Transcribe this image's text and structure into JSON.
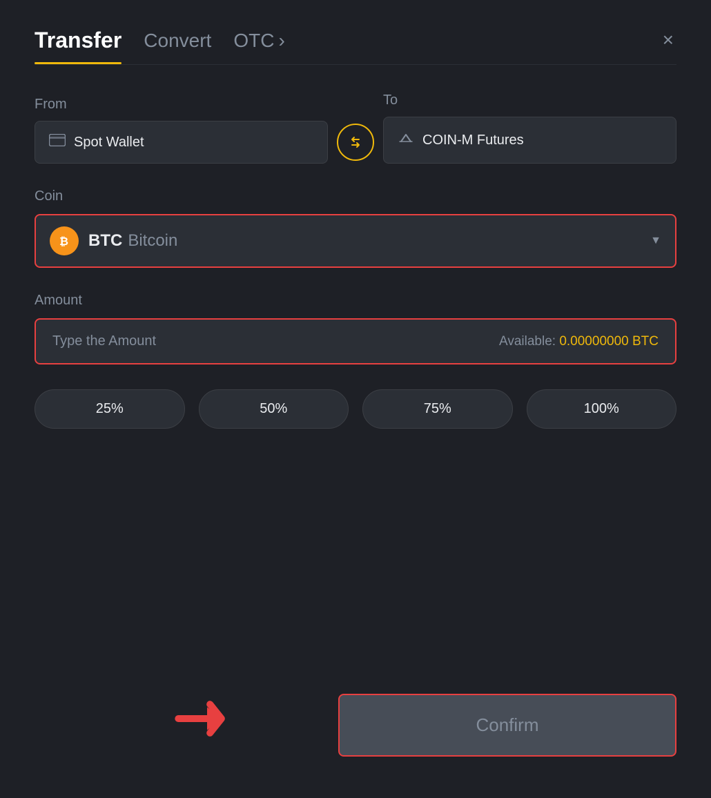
{
  "header": {
    "tab_transfer": "Transfer",
    "tab_convert": "Convert",
    "tab_otc": "OTC",
    "close_label": "×"
  },
  "from_section": {
    "label": "From",
    "wallet_icon": "🪙",
    "wallet_name": "Spot Wallet"
  },
  "to_section": {
    "label": "To",
    "wallet_icon": "↑",
    "wallet_name": "COIN-M Futures"
  },
  "swap": {
    "icon": "⇄"
  },
  "coin_section": {
    "label": "Coin",
    "symbol": "BTC",
    "name": "Bitcoin",
    "btc_letter": "₿"
  },
  "amount_section": {
    "label": "Amount",
    "placeholder": "Type the Amount",
    "available_label": "Available:",
    "available_value": "0.00000000 BTC"
  },
  "percentage_buttons": [
    {
      "label": "25%"
    },
    {
      "label": "50%"
    },
    {
      "label": "75%"
    },
    {
      "label": "100%"
    }
  ],
  "confirm": {
    "button_label": "Confirm"
  }
}
